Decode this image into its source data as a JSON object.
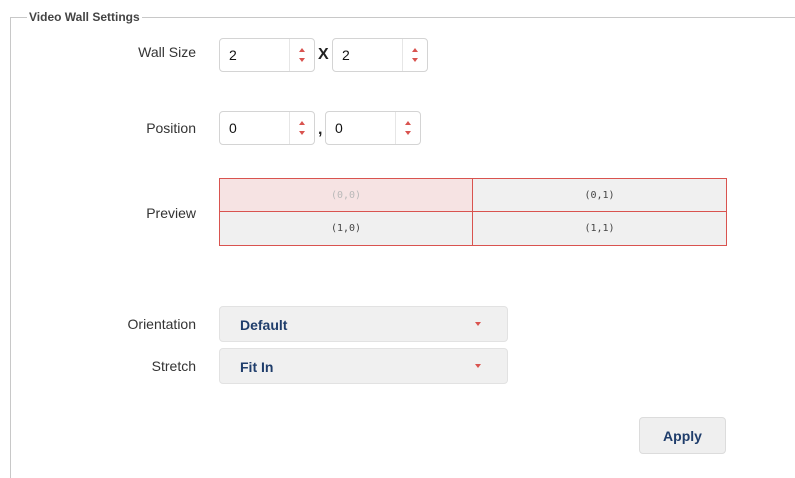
{
  "panel": {
    "legend": "Video Wall Settings"
  },
  "wall_size": {
    "label": "Wall Size",
    "columns": "2",
    "separator": "X",
    "rows": "2"
  },
  "position": {
    "label": "Position",
    "row": "0",
    "separator": ",",
    "col": "0"
  },
  "preview": {
    "label": "Preview",
    "cells": [
      "(0,0)",
      "(0,1)",
      "(1,0)",
      "(1,1)"
    ],
    "selected": "(0,0)"
  },
  "orientation": {
    "label": "Orientation",
    "value": "Default"
  },
  "stretch": {
    "label": "Stretch",
    "value": "Fit In"
  },
  "actions": {
    "apply_label": "Apply"
  },
  "colors": {
    "accent": "#d9534f",
    "value_text": "#1f3d6b"
  },
  "icons": {
    "spinner": "up-down-arrows-icon",
    "dropdown": "caret-down-icon"
  }
}
